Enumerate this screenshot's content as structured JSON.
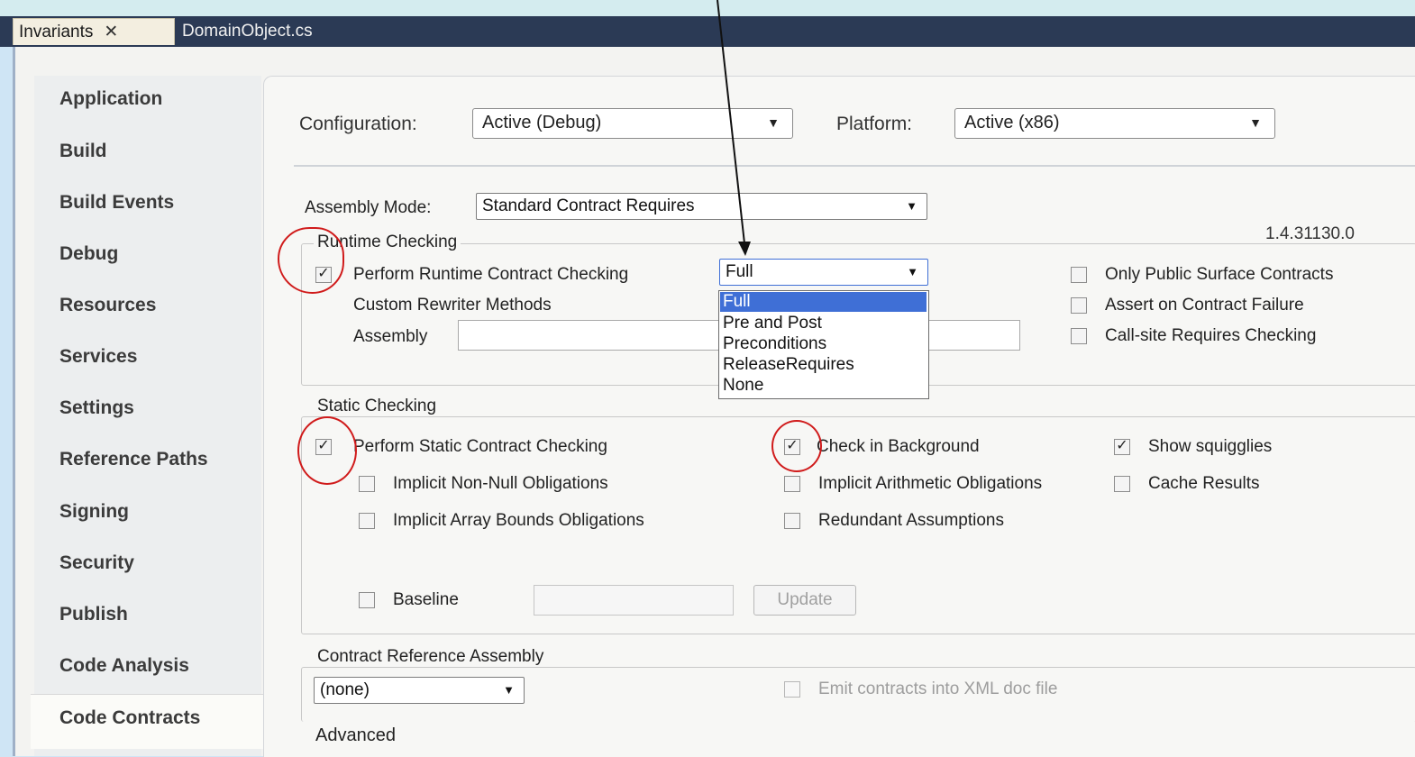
{
  "tabs": [
    {
      "label": "Invariants",
      "close_glyph": "✕",
      "active": true
    },
    {
      "label": "DomainObject.cs",
      "active": false
    }
  ],
  "nav": {
    "items": [
      "Application",
      "Build",
      "Build Events",
      "Debug",
      "Resources",
      "Services",
      "Settings",
      "Reference Paths",
      "Signing",
      "Security",
      "Publish",
      "Code Analysis",
      "Code Contracts"
    ],
    "selected": "Code Contracts"
  },
  "config": {
    "configuration_label": "Configuration:",
    "configuration_value": "Active (Debug)",
    "platform_label": "Platform:",
    "platform_value": "Active (x86)"
  },
  "assembly_mode": {
    "label": "Assembly Mode:",
    "value": "Standard Contract Requires"
  },
  "version": "1.4.31130.0",
  "runtime": {
    "group_title": "Runtime Checking",
    "perform_label": "Perform Runtime Contract Checking",
    "perform_checked": true,
    "level_value": "Full",
    "level_options": [
      "Full",
      "Pre and Post",
      "Preconditions",
      "ReleaseRequires",
      "None"
    ],
    "custom_rewriter_label": "Custom Rewriter Methods",
    "assembly_label": "Assembly",
    "only_public_label": "Only Public Surface Contracts",
    "assert_on_failure_label": "Assert on Contract Failure",
    "callsite_label": "Call-site Requires Checking"
  },
  "static": {
    "group_title": "Static Checking",
    "perform_label": "Perform Static Contract Checking",
    "perform_checked": true,
    "check_background_label": "Check in Background",
    "check_background_checked": true,
    "show_squiggles_label": "Show squigglies",
    "show_squiggles_checked": true,
    "implicit_nonnull_label": "Implicit Non-Null Obligations",
    "implicit_arith_label": "Implicit Arithmetic Obligations",
    "cache_results_label": "Cache Results",
    "implicit_array_label": "Implicit Array Bounds Obligations",
    "redundant_label": "Redundant Assumptions",
    "baseline_label": "Baseline",
    "update_label": "Update"
  },
  "reference": {
    "group_title": "Contract Reference Assembly",
    "value": "(none)",
    "emit_label": "Emit contracts into XML doc file"
  },
  "advanced_title": "Advanced",
  "colors": {
    "annotation": "#d01b1b",
    "selection": "#3f6fd6",
    "tabbar": "#2b3a55"
  }
}
